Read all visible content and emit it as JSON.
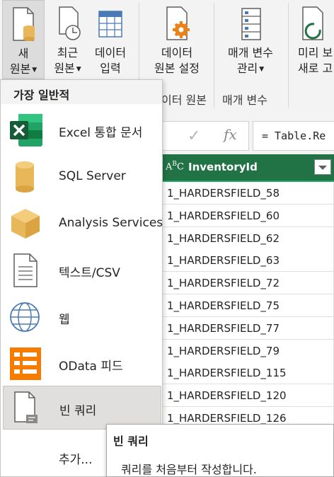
{
  "ribbon": {
    "new_source": {
      "line1": "새",
      "line2": "원본"
    },
    "recent_source": {
      "line1": "최근",
      "line2": "원본"
    },
    "enter_data": {
      "line1": "데이터",
      "line2": "입력"
    },
    "data_source_settings": {
      "line1": "데이터",
      "line2": "원본 설정"
    },
    "manage_parameters": {
      "line1": "매개 변수",
      "line2": "관리"
    },
    "refresh_preview": {
      "line1": "미리 보",
      "line2": "새로 고"
    },
    "group_data_sources": "이터 원본",
    "group_parameters": "매개 변수"
  },
  "formula": {
    "expression": "= Table.Re"
  },
  "grid": {
    "column_name": "InventoryId",
    "column_type_label": "ABC",
    "rows": [
      "1_HARDERSFIELD_58",
      "1_HARDERSFIELD_60",
      "1_HARDERSFIELD_62",
      "1_HARDERSFIELD_63",
      "1_HARDERSFIELD_72",
      "1_HARDERSFIELD_75",
      "1_HARDERSFIELD_77",
      "1_HARDERSFIELD_79",
      "1_HARDERSFIELD_115",
      "1_HARDERSFIELD_120",
      "1_HARDERSFIELD_126"
    ]
  },
  "menu": {
    "section_title": "가장 일반적",
    "items": [
      {
        "label": "Excel 통합 문서",
        "icon": "excel-icon"
      },
      {
        "label": "SQL Server",
        "icon": "database-icon"
      },
      {
        "label": "Analysis Services",
        "icon": "cube-icon"
      },
      {
        "label": "텍스트/CSV",
        "icon": "text-file-icon"
      },
      {
        "label": "웹",
        "icon": "globe-icon"
      },
      {
        "label": "OData 피드",
        "icon": "odata-icon"
      },
      {
        "label": "빈 쿼리",
        "icon": "blank-query-icon"
      }
    ],
    "more": "추가..."
  },
  "tooltip": {
    "title": "빈 쿼리",
    "description": "쿼리를 처음부터 작성합니다."
  },
  "colors": {
    "header_green": "#217346",
    "excel_green": "#1e7145",
    "sql_yellow": "#e8b75a",
    "odata_orange": "#f57c00",
    "globe_blue": "#4a7ab6",
    "gear_orange": "#e8821a"
  }
}
